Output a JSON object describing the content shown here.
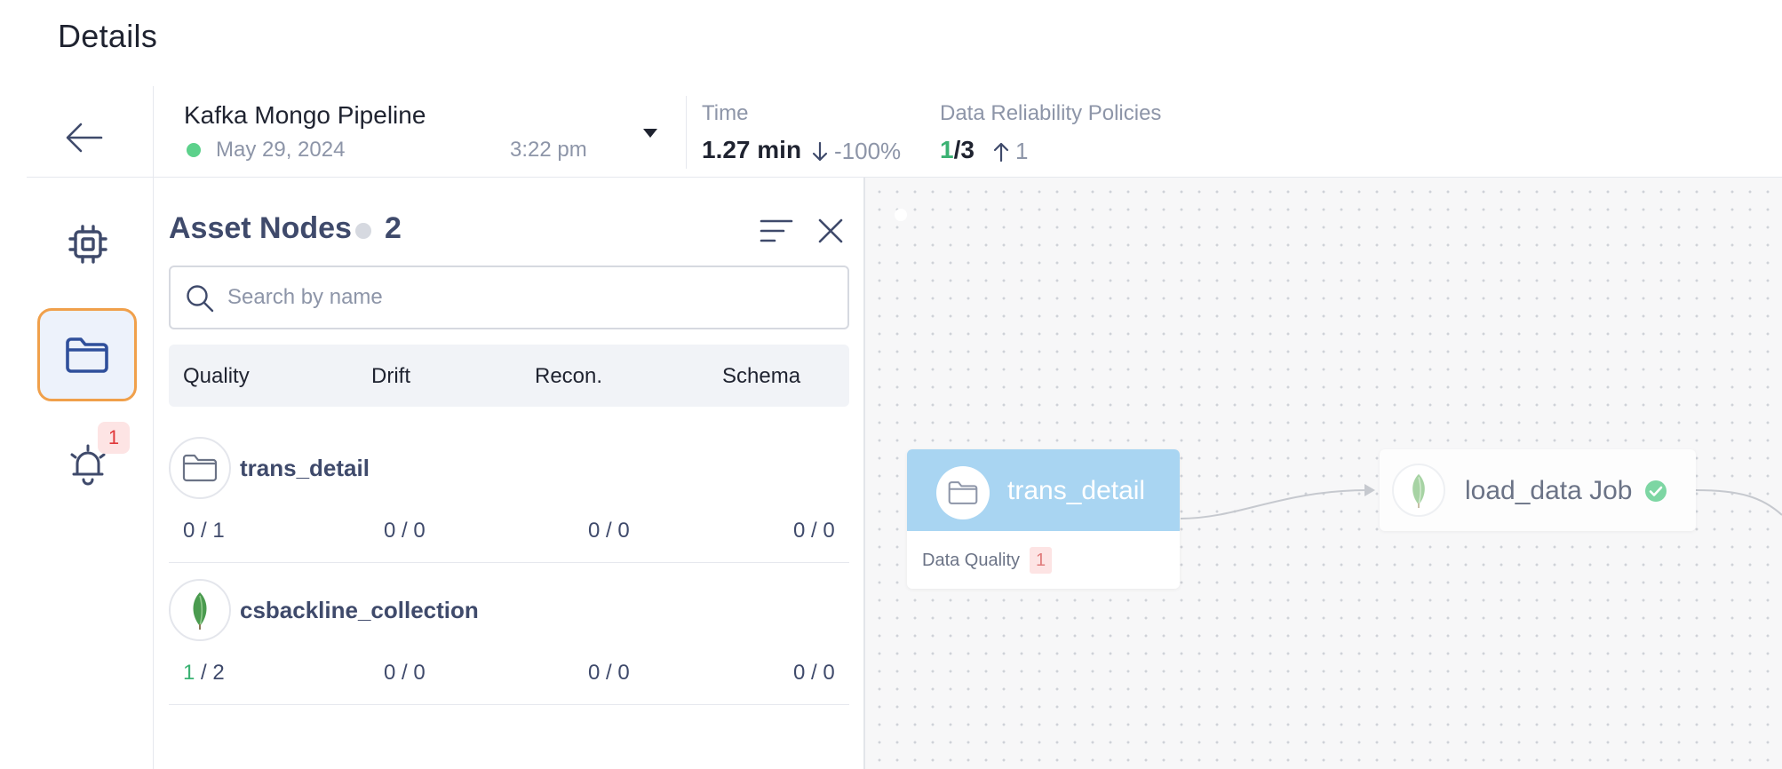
{
  "page": {
    "title": "Details"
  },
  "pipeline": {
    "name": "Kafka Mongo Pipeline",
    "status_color": "#5cd18b",
    "date": "May 29, 2024",
    "time": "3:22 pm"
  },
  "stats": {
    "time": {
      "label": "Time",
      "value": "1.27 min",
      "change": "-100%",
      "change_icon": "arrow-down-icon"
    },
    "policies": {
      "label": "Data Reliability Policies",
      "passed": "1",
      "total": "/3",
      "change": "1",
      "change_icon": "arrow-up-icon"
    }
  },
  "rail": {
    "items": [
      {
        "name": "compute",
        "icon": "chip-icon"
      },
      {
        "name": "assets",
        "icon": "folder-icon",
        "active": true
      },
      {
        "name": "alerts",
        "icon": "alarm-bell-icon",
        "badge": "1"
      }
    ]
  },
  "asset_panel": {
    "title": "Asset Nodes",
    "count": "2",
    "search_placeholder": "Search by name",
    "columns": [
      "Quality",
      "Drift",
      "Recon.",
      "Schema"
    ],
    "assets": [
      {
        "name": "trans_detail",
        "icon": "folder-icon",
        "quality_ok": "0",
        "quality_rest": " / 1",
        "drift": "0 / 0",
        "recon": "0 / 0",
        "schema": "0 / 0"
      },
      {
        "name": "csbackline_collection",
        "icon": "mongodb-leaf-icon",
        "quality_ok": "1",
        "quality_rest": " / 2",
        "drift": "0 / 0",
        "recon": "0 / 0",
        "schema": "0 / 0"
      }
    ]
  },
  "canvas": {
    "nodes": [
      {
        "title": "trans_detail",
        "icon": "folder-icon",
        "footer_label": "Data Quality",
        "footer_badge": "1",
        "header_color": "#a9d5f2"
      },
      {
        "title": "load_data Job",
        "icon": "mongodb-leaf-icon",
        "status_icon": "check-circle-icon",
        "status_color": "#5cd18b"
      }
    ]
  },
  "colors": {
    "accent": "#3f4a6b",
    "active_border": "#f0a04b",
    "success": "#3bb273",
    "danger": "#e0393b"
  }
}
